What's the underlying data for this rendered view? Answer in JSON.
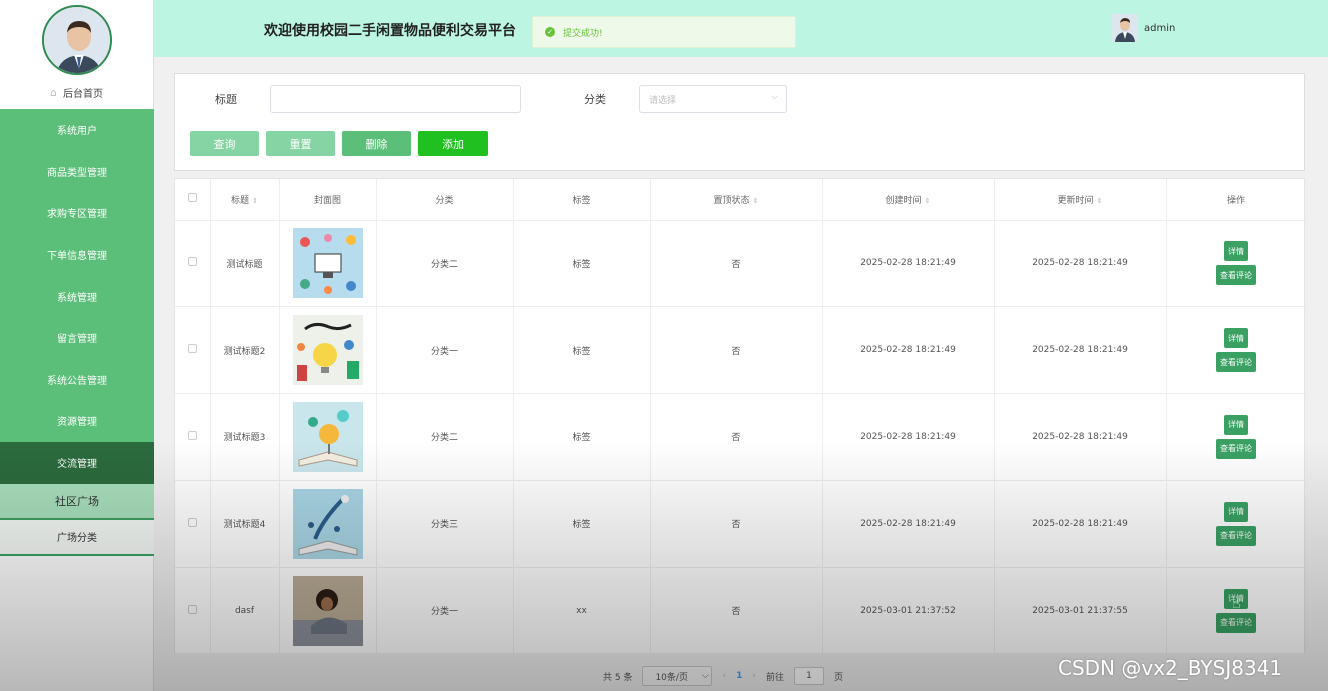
{
  "header": {
    "title": "欢迎使用校园二手闲置物品便利交易平台",
    "toast": "提交成功!",
    "username": "admin"
  },
  "sidebar": {
    "home": "后台首页",
    "items": [
      "系统用户",
      "商品类型管理",
      "求购专区管理",
      "下单信息管理",
      "系统管理",
      "留言管理",
      "系统公告管理",
      "资源管理",
      "交流管理"
    ],
    "submenu": [
      "社区广场",
      "广场分类"
    ]
  },
  "search": {
    "title_label": "标题",
    "category_label": "分类",
    "category_placeholder": "请选择",
    "buttons": [
      "查询",
      "重置",
      "删除",
      "添加"
    ]
  },
  "table": {
    "headers": [
      "标题",
      "封面图",
      "分类",
      "标签",
      "置顶状态",
      "创建时间",
      "更新时间",
      "操作"
    ],
    "rows": [
      {
        "title": "测试标题",
        "category": "分类二",
        "tag": "标签",
        "pinned": "否",
        "created": "2025-02-28 18:21:49",
        "updated": "2025-02-28 18:21:49"
      },
      {
        "title": "测试标题2",
        "category": "分类一",
        "tag": "标签",
        "pinned": "否",
        "created": "2025-02-28 18:21:49",
        "updated": "2025-02-28 18:21:49"
      },
      {
        "title": "测试标题3",
        "category": "分类二",
        "tag": "标签",
        "pinned": "否",
        "created": "2025-02-28 18:21:49",
        "updated": "2025-02-28 18:21:49"
      },
      {
        "title": "测试标题4",
        "category": "分类三",
        "tag": "标签",
        "pinned": "否",
        "created": "2025-02-28 18:21:49",
        "updated": "2025-02-28 18:21:49"
      },
      {
        "title": "dasf",
        "category": "分类一",
        "tag": "xx",
        "pinned": "否",
        "created": "2025-03-01 21:37:52",
        "updated": "2025-03-01 21:37:55"
      }
    ],
    "op_detail": "详情",
    "op_comments": "查看评论"
  },
  "pager": {
    "total": "共 5 条",
    "page_size": "10条/页",
    "current": "1",
    "goto": "前往",
    "goto_value": "1",
    "page_unit": "页"
  },
  "watermark": "CSDN @vx2_BYSJ8341",
  "colors": {
    "header_bg": "#bdf5e3",
    "menu_green": "#5cbf79",
    "menu_active": "#2b6b3d",
    "button_green": "#3aa163",
    "add_button": "#1fc01f"
  }
}
